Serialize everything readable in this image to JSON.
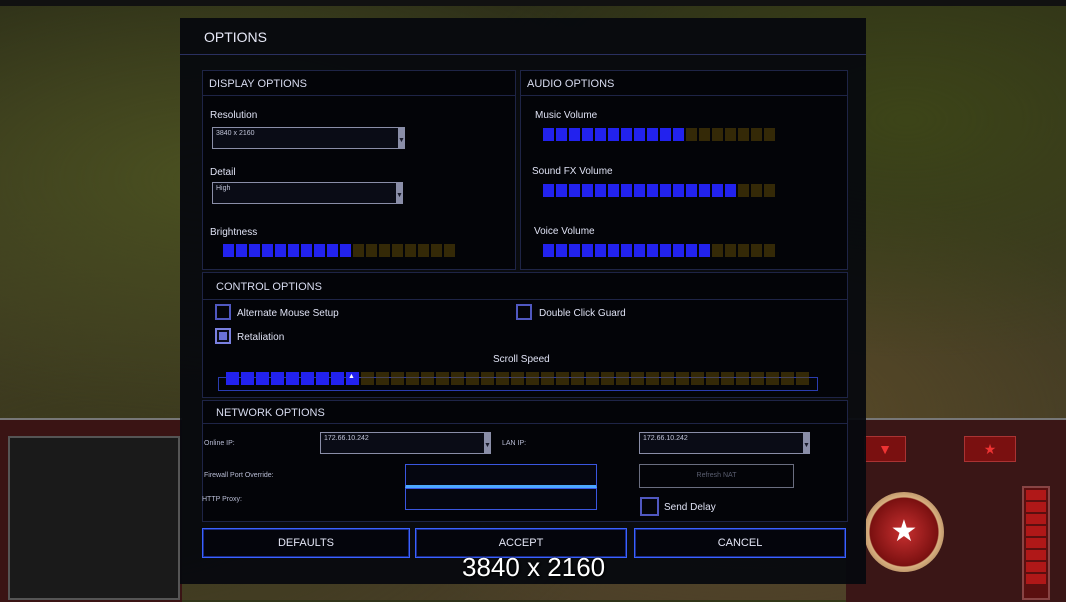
{
  "window": {
    "title": "OPTIONS"
  },
  "display": {
    "header": "DISPLAY OPTIONS",
    "resolution_label": "Resolution",
    "resolution_value": "3840 x 2160",
    "detail_label": "Detail",
    "detail_value": "High",
    "brightness_label": "Brightness",
    "brightness_level": {
      "filled": 10,
      "total": 18
    }
  },
  "audio": {
    "header": "AUDIO OPTIONS",
    "music_label": "Music Volume",
    "music_level": {
      "filled": 11,
      "total": 18
    },
    "sfx_label": "Sound FX Volume",
    "sfx_level": {
      "filled": 15,
      "total": 18
    },
    "voice_label": "Voice Volume",
    "voice_level": {
      "filled": 13,
      "total": 18
    }
  },
  "control": {
    "header": "CONTROL OPTIONS",
    "alt_mouse_label": "Alternate Mouse Setup",
    "alt_mouse_checked": false,
    "double_click_label": "Double Click Guard",
    "double_click_checked": false,
    "retaliation_label": "Retaliation",
    "retaliation_checked": true,
    "scroll_label": "Scroll Speed",
    "scroll_level": {
      "filled": 9,
      "total": 39
    }
  },
  "network": {
    "header": "NETWORK OPTIONS",
    "online_ip_label": "Online IP:",
    "online_ip_value": "172.66.10.242",
    "lan_ip_label": "LAN IP:",
    "lan_ip_value": "172.66.10.242",
    "firewall_label": "Firewall Port Override:",
    "firewall_value": "",
    "http_proxy_label": "HTTP Proxy:",
    "http_proxy_value": "",
    "refresh_nat_label": "Refresh NAT",
    "send_delay_label": "Send Delay",
    "send_delay_checked": false
  },
  "buttons": {
    "defaults": "DEFAULTS",
    "accept": "ACCEPT",
    "cancel": "CANCEL"
  },
  "overlay_caption": "3840 x 2160",
  "colors": {
    "slider_on": "#2222ee",
    "slider_off": "#5c4808",
    "button_border": "#3a62ff",
    "checkbox_border": "#5058c0"
  }
}
